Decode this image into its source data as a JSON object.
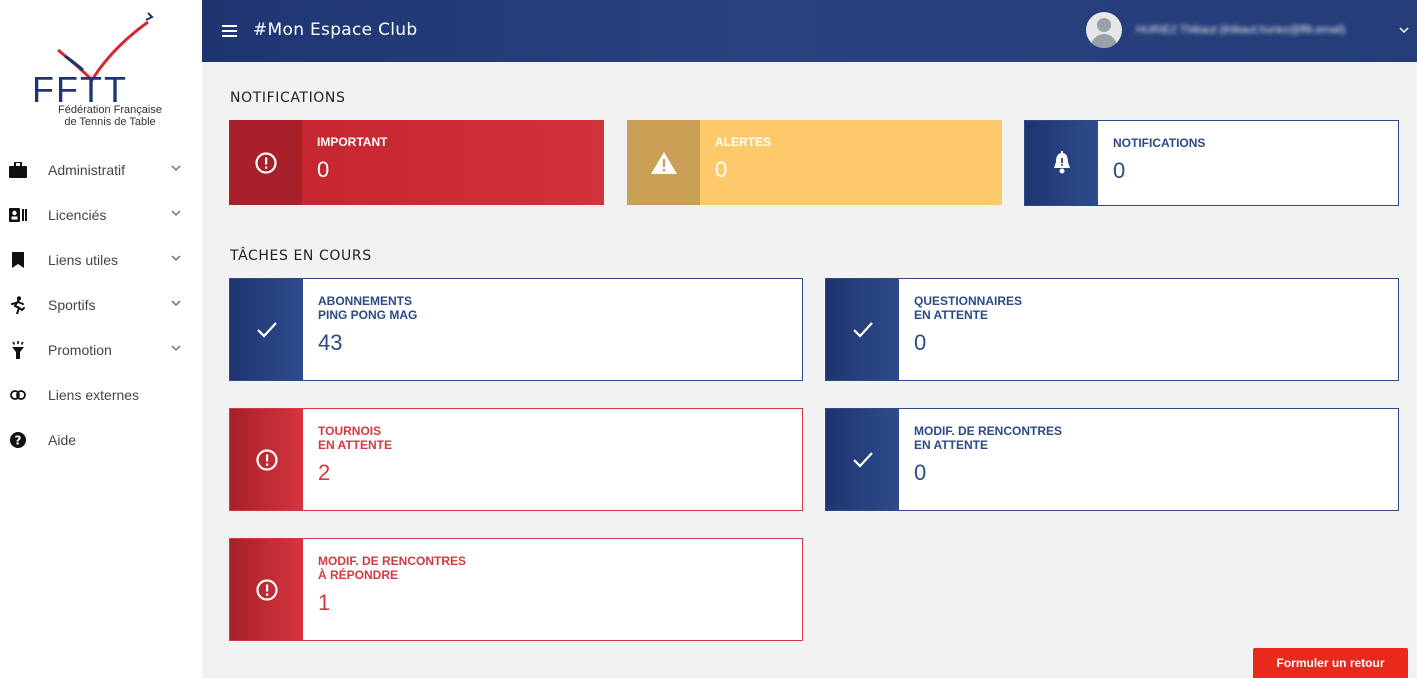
{
  "app": {
    "title": "#Mon Espace Club",
    "user_name": "HURIEZ Thibaut (thibaut.huriez@fftt.email)"
  },
  "logo": {
    "text": "FFTT",
    "subtitle_line1": "Fédération Française",
    "subtitle_line2": "de Tennis de Table"
  },
  "sidebar": {
    "items": [
      {
        "label": "Administratif",
        "icon": "briefcase-icon",
        "expandable": true
      },
      {
        "label": "Licenciés",
        "icon": "id-card-icon",
        "expandable": true
      },
      {
        "label": "Liens utiles",
        "icon": "bookmark-icon",
        "expandable": true
      },
      {
        "label": "Sportifs",
        "icon": "running-icon",
        "expandable": true
      },
      {
        "label": "Promotion",
        "icon": "torch-icon",
        "expandable": true
      },
      {
        "label": "Liens externes",
        "icon": "link-icon",
        "expandable": false
      },
      {
        "label": "Aide",
        "icon": "help-icon",
        "expandable": false
      }
    ]
  },
  "notifications": {
    "title": "NOTIFICATIONS",
    "cards": [
      {
        "label": "IMPORTANT",
        "value": "0",
        "icon": "exclamation-circle-icon",
        "color": "#c5262f"
      },
      {
        "label": "ALERTES",
        "value": "0",
        "icon": "warning-triangle-icon",
        "color": "#fec96b"
      },
      {
        "label": "NOTIFICATIONS",
        "value": "0",
        "icon": "bell-icon",
        "color": "#2b4a86"
      }
    ]
  },
  "tasks": {
    "title": "TÂCHES EN COURS",
    "cards": [
      {
        "label_line1": "ABONNEMENTS",
        "label_line2": "PING PONG MAG",
        "value": "43",
        "icon": "check-icon"
      },
      {
        "label_line1": "QUESTIONNAIRES",
        "label_line2": "EN ATTENTE",
        "value": "0",
        "icon": "check-icon"
      },
      {
        "label_line1": "TOURNOIS",
        "label_line2": "EN ATTENTE",
        "value": "2",
        "icon": "exclamation-circle-icon"
      },
      {
        "label_line1": "MODIF. DE RENCONTRES",
        "label_line2": "EN ATTENTE",
        "value": "0",
        "icon": "check-icon"
      },
      {
        "label_line1": "MODIF. DE RENCONTRES",
        "label_line2": "À RÉPONDRE",
        "value": "1",
        "icon": "exclamation-circle-icon"
      }
    ]
  },
  "feedback_button": "Formuler un retour",
  "colors": {
    "navy": "#1e3570",
    "red": "#c5262f",
    "yellow": "#fec96b",
    "feedback_red": "#e8291c"
  }
}
